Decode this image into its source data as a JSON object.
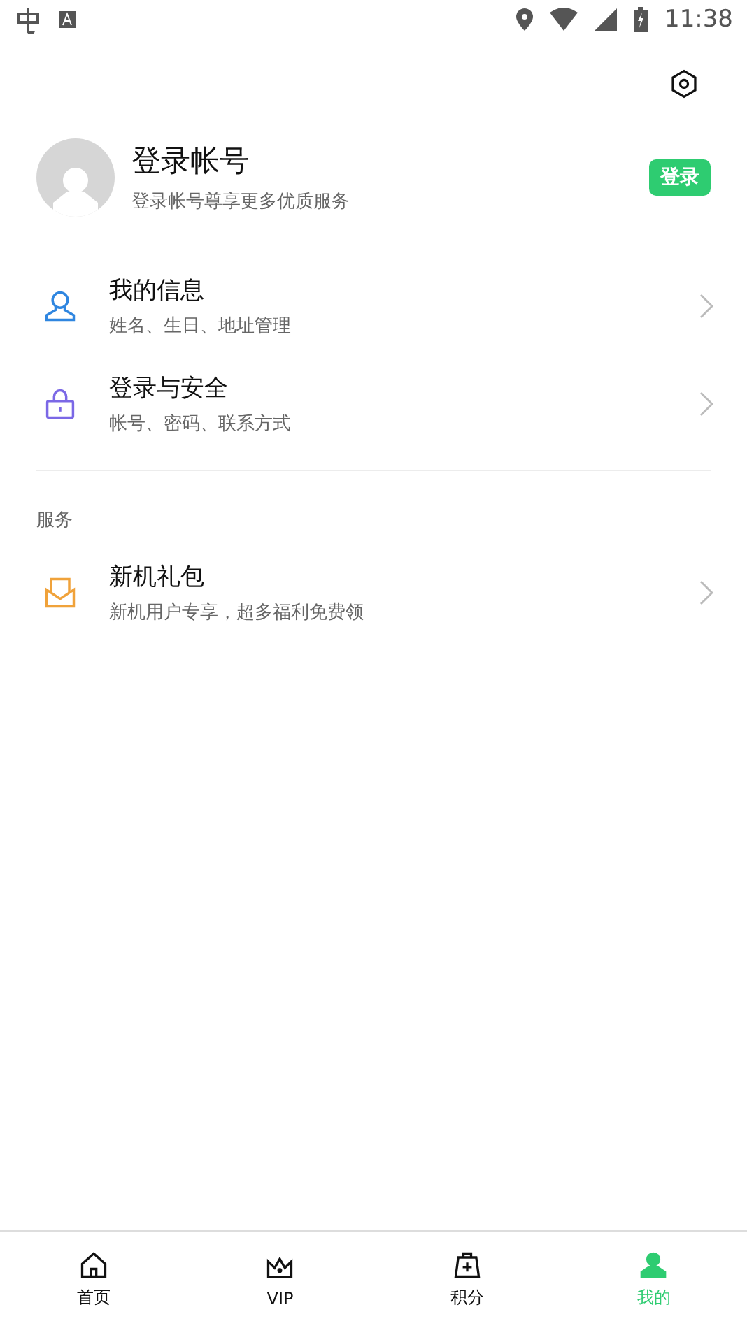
{
  "status_bar": {
    "time": "11:38"
  },
  "profile": {
    "name": "登录帐号",
    "subtitle": "登录帐号尊享更多优质服务",
    "login_button": "登录"
  },
  "account_items": [
    {
      "kind": "person",
      "color": "#2f86e0",
      "title": "我的信息",
      "subtitle": "姓名、生日、地址管理"
    },
    {
      "kind": "lock",
      "color": "#7b68e6",
      "title": "登录与安全",
      "subtitle": "帐号、密码、联系方式"
    }
  ],
  "services": {
    "heading": "服务",
    "items": [
      {
        "kind": "gift",
        "color": "#f0a23a",
        "title": "新机礼包",
        "subtitle": "新机用户专享，超多福利免费领"
      }
    ]
  },
  "tabs": [
    {
      "kind": "home",
      "label": "首页",
      "selected": false
    },
    {
      "kind": "crown",
      "label": "VIP",
      "selected": false
    },
    {
      "kind": "bag",
      "label": "积分",
      "selected": false
    },
    {
      "kind": "user",
      "label": "我的",
      "selected": true
    }
  ]
}
